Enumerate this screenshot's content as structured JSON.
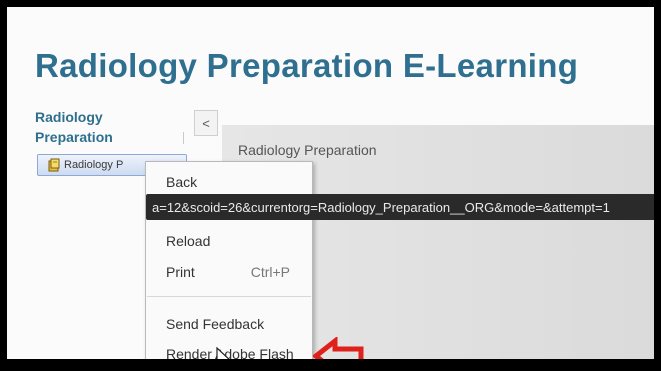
{
  "page": {
    "title": "Radiology Preparation E-Learning"
  },
  "sidebar": {
    "title": "Radiology Preparation",
    "collapse_label": "<",
    "tree_item_label": "Radiology P",
    "tree_icon": "book-icon"
  },
  "content": {
    "header": "Radiology Preparation"
  },
  "context_menu": {
    "items": [
      {
        "label": "Back",
        "shortcut": ""
      },
      {
        "label": "Reload",
        "shortcut": ""
      },
      {
        "label": "Print",
        "shortcut": "Ctrl+P"
      },
      {
        "label": "Send Feedback",
        "shortcut": ""
      },
      {
        "label": "Render Adobe Flash",
        "shortcut": ""
      }
    ]
  },
  "url_tooltip": "a=12&scoid=26&currentorg=Radiology_Preparation__ORG&mode=&attempt=1",
  "annotation": {
    "arrow_color": "#e0201b",
    "arrow_icon": "left-arrow-icon"
  },
  "colors": {
    "title": "#2f6f8f",
    "frame": "#000000"
  }
}
